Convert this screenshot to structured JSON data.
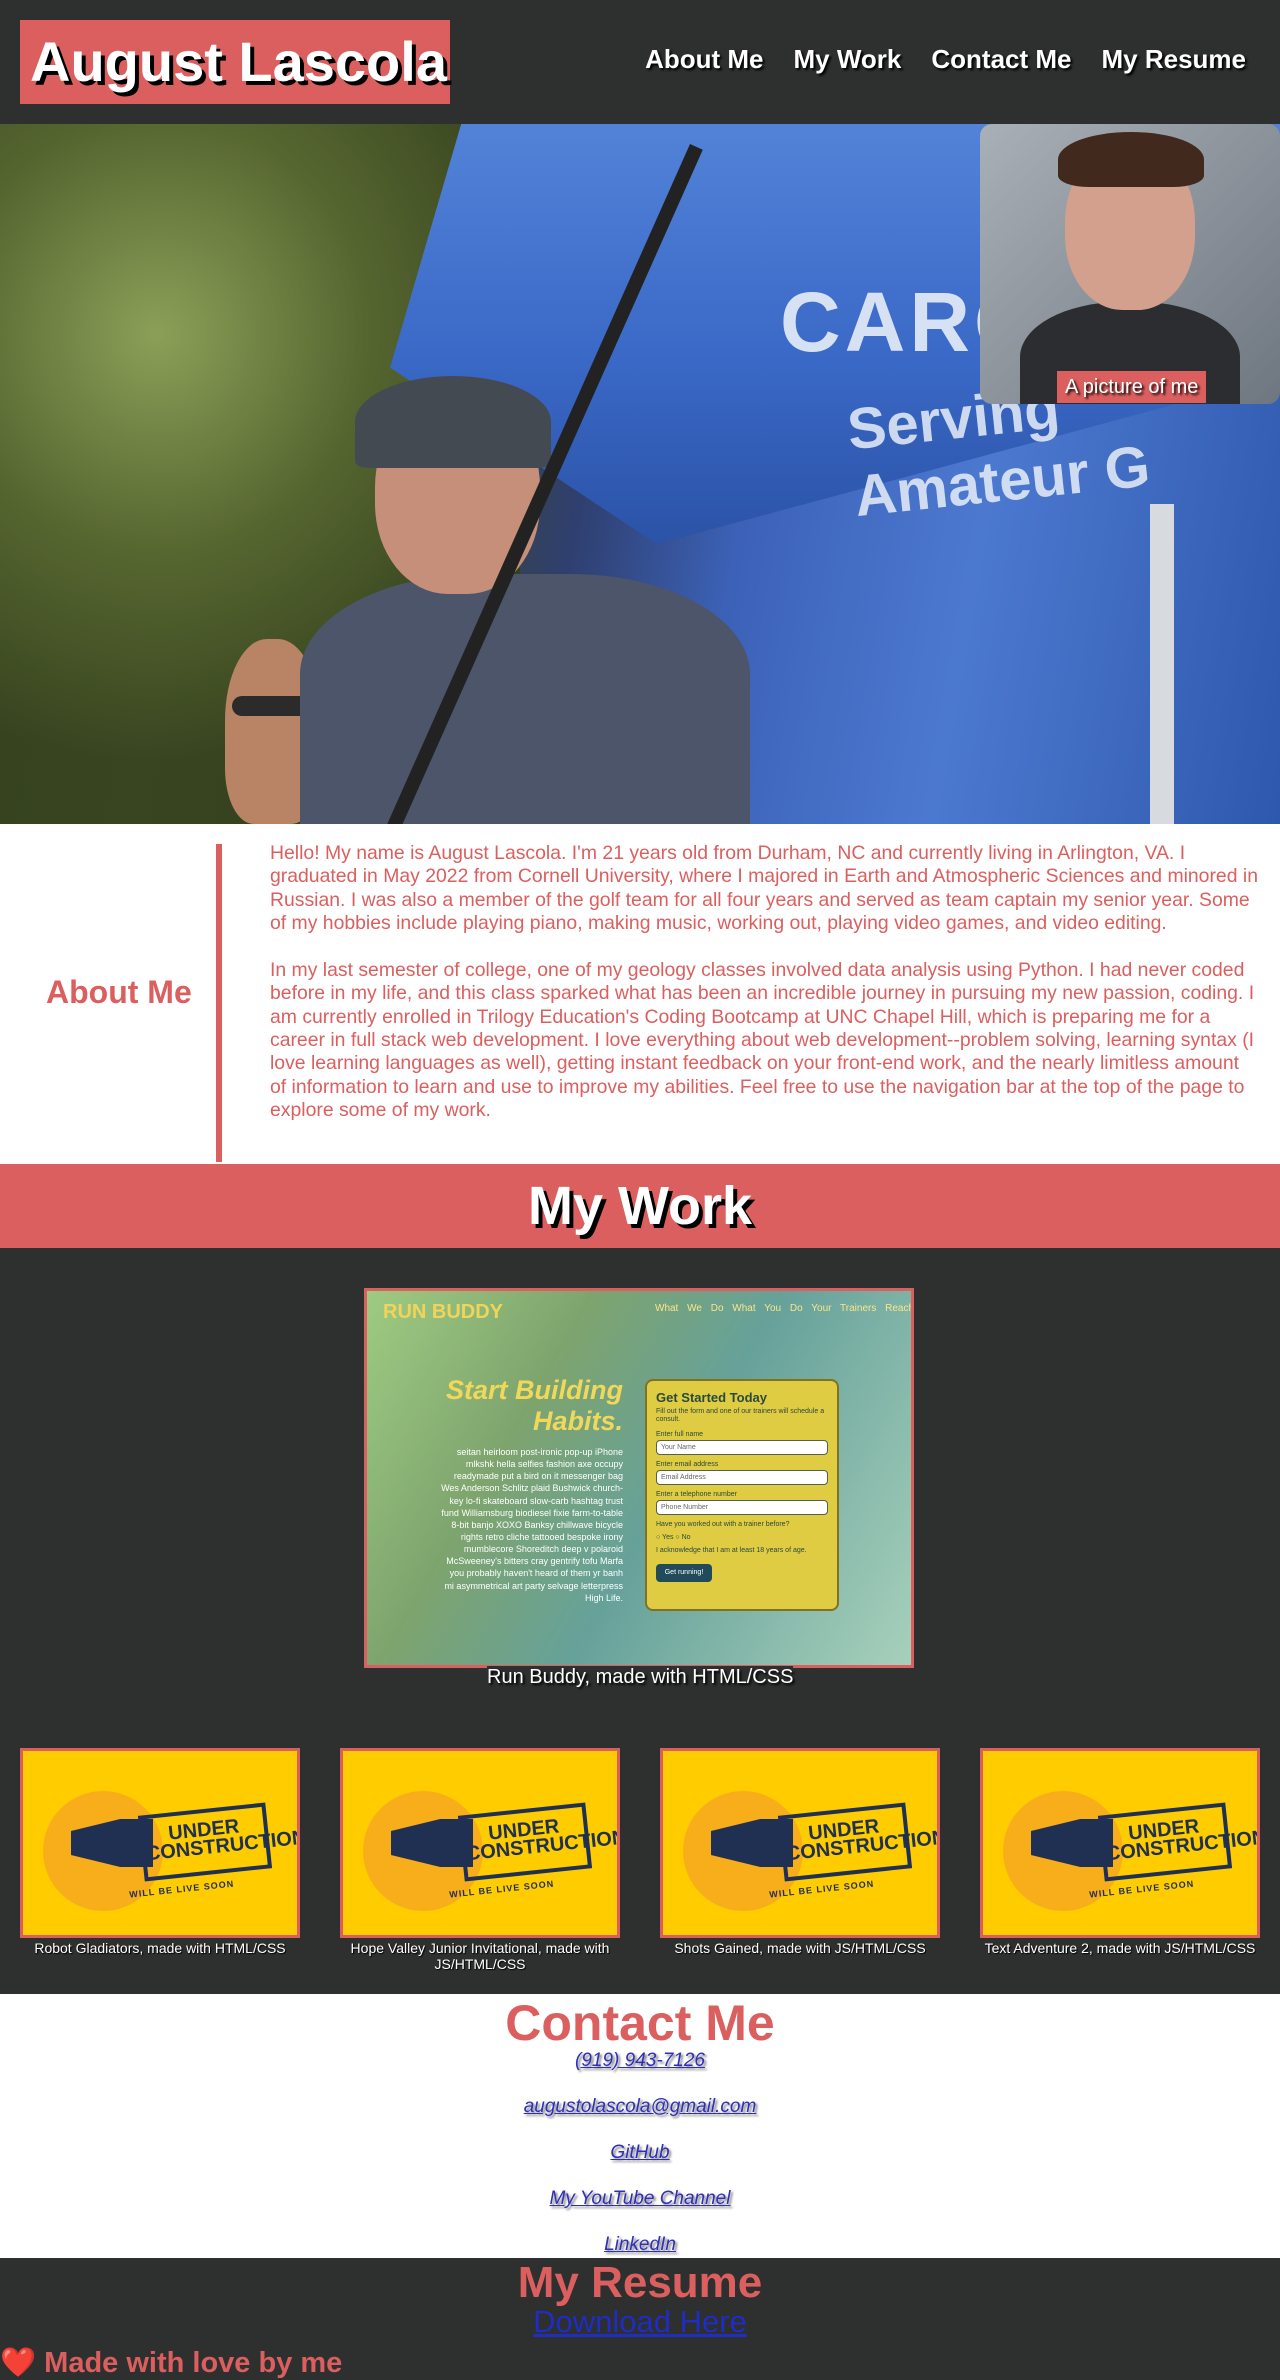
{
  "header": {
    "title": "August Lascola",
    "nav": [
      "About Me",
      "My Work",
      "Contact Me",
      "My Resume"
    ]
  },
  "hero": {
    "portrait_caption": "A picture of me"
  },
  "about": {
    "title": "About Me",
    "paragraphs": [
      "Hello! My name is August Lascola. I'm 21 years old from Durham, NC and currently living in Arlington, VA. I graduated in May 2022 from Cornell University, where I majored in Earth and Atmospheric Sciences and minored in Russian. I was also a member of the golf team for all four years and served as team captain my senior year. Some of my hobbies include playing piano, making music, working out, playing video games, and video editing.",
      "In my last semester of college, one of my geology classes involved data analysis using Python. I had never coded before in my life, and this class sparked what has been an incredible journey in pursuing my new passion, coding. I am currently enrolled in Trilogy Education's Coding Bootcamp at UNC Chapel Hill, which is preparing me for a career in full stack web development. I love everything about web development--problem solving, learning syntax (I love learning languages as well), getting instant feedback on your front-end work, and the nearly limitless amount of information to learn and use to improve my abilities. Feel free to use the navigation bar at the top of the page to explore some of my work."
    ]
  },
  "work": {
    "title": "My Work",
    "featured": {
      "caption": "Run Buddy, made with HTML/CSS",
      "screenshot": {
        "brand": "RUN BUDDY",
        "nav": "What We Do   What You Do   Your Trainers   Reach Out",
        "headline": "Start Building Habits.",
        "copy": "seitan heirloom post-ironic pop-up iPhone mlkshk hella selfies fashion axe occupy readymade put a bird on it messenger bag Wes Anderson Schlitz plaid Bushwick church-key lo-fi skateboard slow-carb hashtag trust fund Williamsburg biodiesel fixie farm-to-table 8-bit banjo XOXO Banksy chillwave bicycle rights retro cliche tattooed bespoke irony mumblecore Shoreditch deep v polaroid McSweeney's bitters cray gentrify tofu Marfa you probably haven't heard of them yr banh mi asymmetrical art party selvage letterpress High Life.",
        "form_title": "Get Started Today",
        "form_note": "Fill out the form and one of our trainers will schedule a consult.",
        "fields": [
          {
            "label": "Enter full name",
            "placeholder": "Your Name"
          },
          {
            "label": "Enter email address",
            "placeholder": "Email Address"
          },
          {
            "label": "Enter a telephone number",
            "placeholder": "Phone Number"
          }
        ],
        "question": "Have you worked out with a trainer before?",
        "yes": "Yes",
        "no": "No",
        "acknowledge": "I acknowledge that I am at least 18 years of age.",
        "button": "Get running!"
      }
    },
    "projects": [
      {
        "caption": "Robot Gladiators, made with HTML/CSS"
      },
      {
        "caption": "Hope Valley Junior Invitational, made with JS/HTML/CSS"
      },
      {
        "caption": "Shots Gained, made with JS/HTML/CSS"
      },
      {
        "caption": "Text Adventure 2, made with JS/HTML/CSS"
      }
    ],
    "placeholder": {
      "line1": "UNDER",
      "line2": "CONSTRUCTION",
      "line3": "WILL BE LIVE SOON"
    }
  },
  "contact": {
    "title": "Contact Me",
    "links": [
      "(919) 943-7126",
      "augustolascola@gmail.com",
      "GitHub",
      "My YouTube Channel",
      "LinkedIn"
    ]
  },
  "resume": {
    "title": "My Resume",
    "download": "Download Here"
  },
  "footer": {
    "text": "❤️ Made with love by me"
  },
  "colors": {
    "accent": "#db5f5f",
    "dark": "#2e2f2f",
    "link": "#2f2fb8"
  }
}
